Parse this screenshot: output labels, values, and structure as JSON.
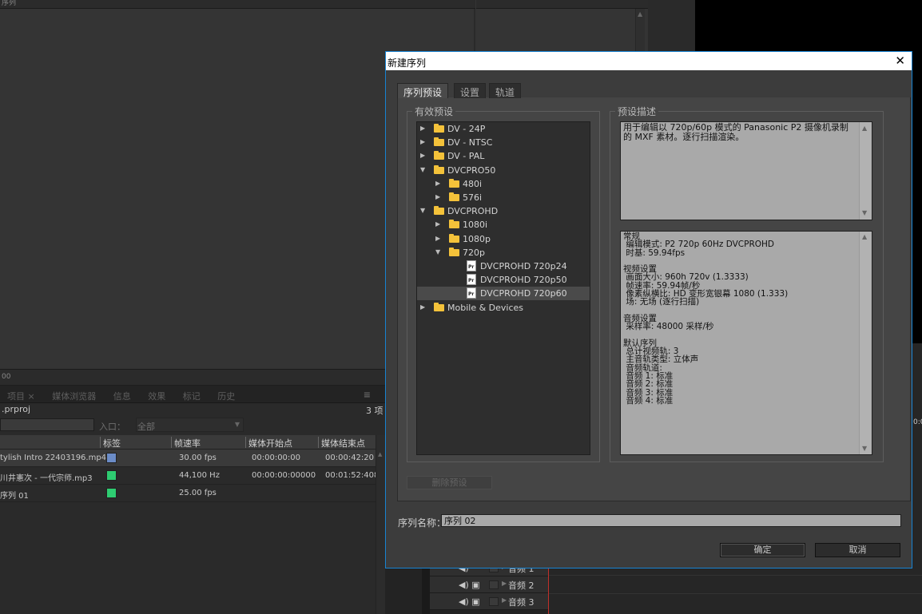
{
  "background": {
    "top_panel_title": "序列",
    "timecode": "00",
    "panel_tabs": [
      "项目 ×",
      "媒体浏览器",
      "信息",
      "效果",
      "标记",
      "历史"
    ],
    "project_file": ".prproj",
    "item_count": "3 项",
    "entry_label": "入口：",
    "entry_value": "全部",
    "columns": [
      "标签",
      "帧速率",
      "媒体开始点",
      "媒体结束点"
    ],
    "rows": [
      {
        "name": "tylish Intro 22403196.mp4",
        "color": "#6b8cc7",
        "fps": "30.00 fps",
        "start": "00:00:00:00",
        "end": "00:00:42:20"
      },
      {
        "name": "川井憲次 - 一代宗师.mp3",
        "color": "#2ecc71",
        "fps": "44,100 Hz",
        "start": "00:00:00:00000",
        "end": "00:01:52:4089"
      },
      {
        "name": "序列 01",
        "color": "#2ecc71",
        "fps": "25.00 fps",
        "start": "",
        "end": ""
      }
    ],
    "timeline_tracks": [
      "音频 1",
      "音频 2",
      "音频 3"
    ],
    "right_time": "0:0"
  },
  "dialog": {
    "title": "新建序列",
    "close": "✕",
    "tabs": [
      "序列预设",
      "设置",
      "轨道"
    ],
    "presets_legend": "有效预设",
    "desc_legend": "预设描述",
    "tree": [
      {
        "label": "DV - 24P",
        "level": 0,
        "type": "folder",
        "open": false
      },
      {
        "label": "DV - NTSC",
        "level": 0,
        "type": "folder",
        "open": false
      },
      {
        "label": "DV - PAL",
        "level": 0,
        "type": "folder",
        "open": false
      },
      {
        "label": "DVCPRO50",
        "level": 0,
        "type": "folder",
        "open": true
      },
      {
        "label": "480i",
        "level": 1,
        "type": "folder",
        "open": false
      },
      {
        "label": "576i",
        "level": 1,
        "type": "folder",
        "open": false
      },
      {
        "label": "DVCPROHD",
        "level": 0,
        "type": "folder",
        "open": true
      },
      {
        "label": "1080i",
        "level": 1,
        "type": "folder",
        "open": false
      },
      {
        "label": "1080p",
        "level": 1,
        "type": "folder",
        "open": false
      },
      {
        "label": "720p",
        "level": 1,
        "type": "folder",
        "open": true
      },
      {
        "label": "DVCPROHD 720p24",
        "level": 2,
        "type": "file"
      },
      {
        "label": "DVCPROHD 720p50",
        "level": 2,
        "type": "file"
      },
      {
        "label": "DVCPROHD 720p60",
        "level": 2,
        "type": "file",
        "selected": true
      },
      {
        "label": "Mobile & Devices",
        "level": 0,
        "type": "folder",
        "open": false
      }
    ],
    "description": "用于编辑以 720p/60p 模式的 Panasonic P2 摄像机录制的 MXF 素材。逐行扫描渲染。",
    "details": "常规\n 编辑模式: P2 720p 60Hz DVCPROHD\n 时基: 59.94fps\n\n视频设置\n 画面大小: 960h 720v (1.3333)\n 帧速率: 59.94帧/秒\n 像素纵横比: HD 变形宽银幕 1080 (1.333)\n 场: 无场 (逐行扫描)\n\n音频设置\n 采样率: 48000 采样/秒\n\n默认序列\n 总计视频轨: 3\n 主音轨类型: 立体声\n 音频轨道:\n 音频 1: 标准\n 音频 2: 标准\n 音频 3: 标准\n 音频 4: 标准",
    "delete_preset": "删除预设",
    "seq_name_label": "序列名称：",
    "seq_name_value": "序列 02",
    "ok": "确定",
    "cancel": "取消"
  }
}
